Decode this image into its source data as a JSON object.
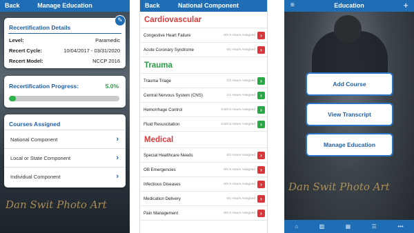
{
  "screen1": {
    "nav": {
      "back": "Back",
      "title": "Manage Education"
    },
    "details": {
      "title": "Recertification Details",
      "rows": [
        {
          "label": "Level:",
          "value": "Paramedic"
        },
        {
          "label": "Recert Cycle:",
          "value": "10/04/2017 - 03/31/2020"
        },
        {
          "label": "Recert Model:",
          "value": "NCCP 2016"
        }
      ]
    },
    "progress": {
      "title": "Recertification Progress:",
      "value_text": "5.0%",
      "value": 0.05
    },
    "courses": {
      "title": "Courses Assigned",
      "items": [
        "National Component",
        "Local or State Component",
        "Individual Component"
      ]
    },
    "signature": "Dan Swit  Photo Art"
  },
  "screen2": {
    "nav": {
      "back": "Back",
      "title": "National Component"
    },
    "sections": [
      {
        "title": "Cardiovascular",
        "color": "#d93a3a",
        "items": [
          {
            "name": "Congestive Heart Failure",
            "hours": "0/0.5 Hours Assigned",
            "status": "red"
          },
          {
            "name": "Acute Coronary Syndrome",
            "hours": "0/1 Hours Assigned",
            "status": "red"
          }
        ]
      },
      {
        "title": "Trauma",
        "color": "#2a9a46",
        "items": [
          {
            "name": "Trauma Triage",
            "hours": "1/1 Hours Assigned",
            "status": "green"
          },
          {
            "name": "Central Nervous System (CNS)",
            "hours": "1/1 Hours Assigned",
            "status": "green"
          },
          {
            "name": "Hemorrhage Control",
            "hours": "0.5/0.5 Hours Assigned",
            "status": "green"
          },
          {
            "name": "Fluid Resuscitation",
            "hours": "0.5/0.5 Hours Assigned",
            "status": "green"
          }
        ]
      },
      {
        "title": "Medical",
        "color": "#d93a3a",
        "items": [
          {
            "name": "Special Healthcare Needs",
            "hours": "0/2 Hours Assigned",
            "status": "red"
          },
          {
            "name": "OB Emergencies",
            "hours": "0/0.5 Hours Assigned",
            "status": "red"
          },
          {
            "name": "Infectious Diseases",
            "hours": "0/0.5 Hours Assigned",
            "status": "red"
          },
          {
            "name": "Medication Delivery",
            "hours": "0/1 Hours Assigned",
            "status": "red"
          },
          {
            "name": "Pain Management",
            "hours": "0/0.5 Hours Assigned",
            "status": "red"
          }
        ]
      }
    ]
  },
  "screen3": {
    "nav": {
      "title": "Education"
    },
    "buttons": [
      "Add Course",
      "View Transcript",
      "Manage Education"
    ],
    "tabs": [
      "home-icon",
      "book-icon",
      "building-icon",
      "list-icon",
      "more-icon"
    ],
    "signature": "Dan Swit  Photo Art"
  }
}
